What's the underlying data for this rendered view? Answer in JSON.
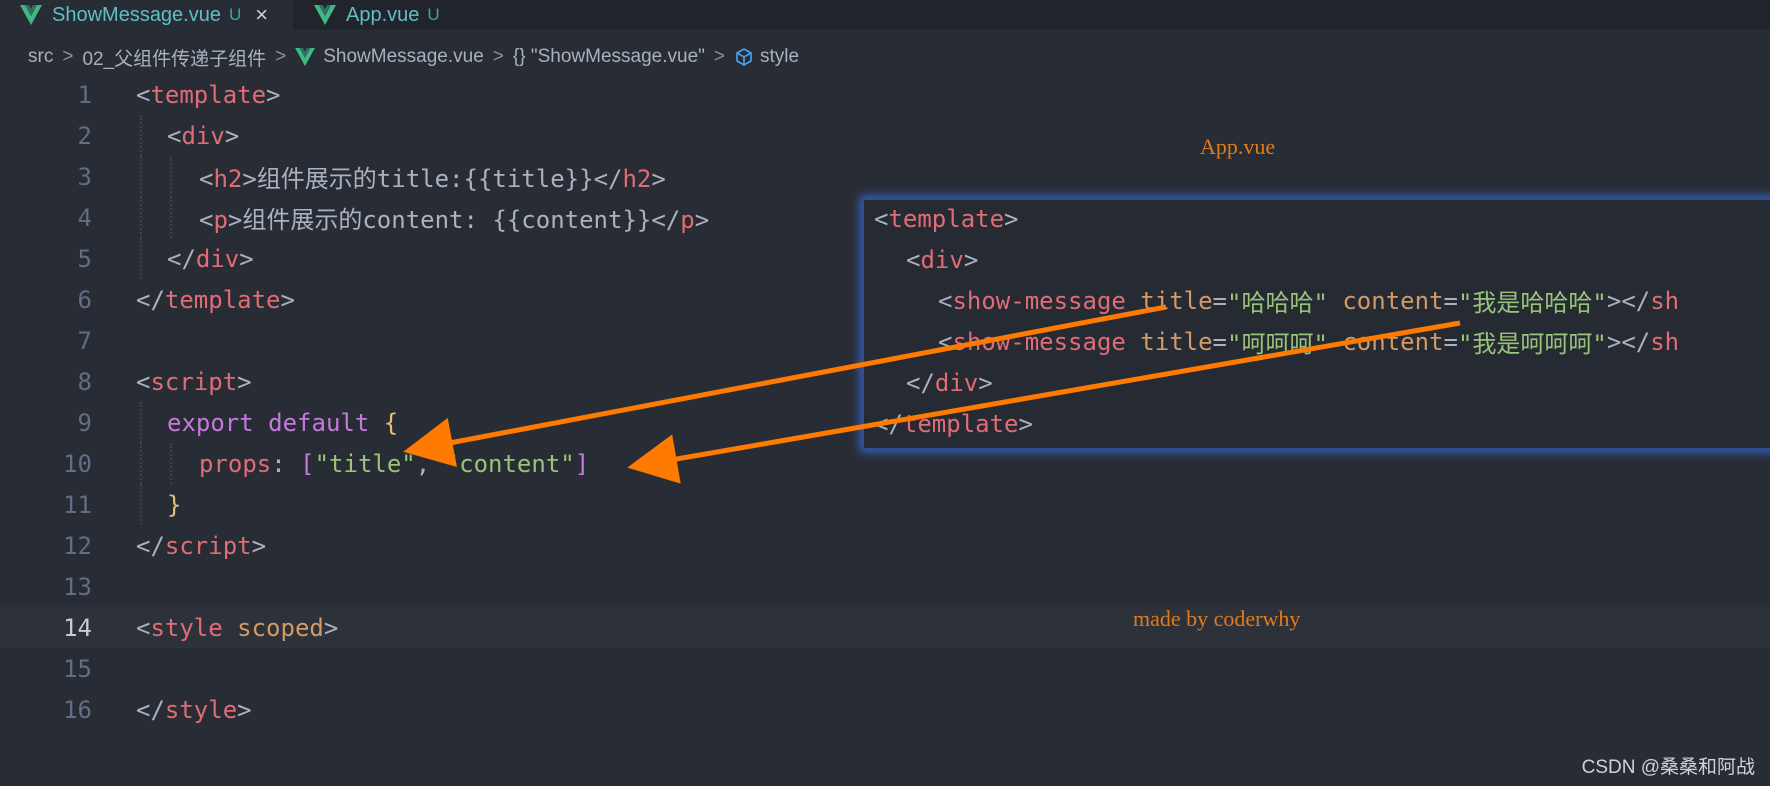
{
  "tabs": [
    {
      "name": "ShowMessage.vue",
      "status": "U",
      "close": "×",
      "icon": "vue-icon"
    },
    {
      "name": "App.vue",
      "status": "U",
      "icon": "vue-icon"
    }
  ],
  "breadcrumb": {
    "src": "src",
    "folder": "02_父组件传递子组件",
    "file": "ShowMessage.vue",
    "scope": "{} \"ShowMessage.vue\"",
    "symbol": "style",
    "separator": ">"
  },
  "editor": {
    "current_line": 14,
    "lines": [
      {
        "n": "1"
      },
      {
        "n": "2"
      },
      {
        "n": "3"
      },
      {
        "n": "4"
      },
      {
        "n": "5"
      },
      {
        "n": "6"
      },
      {
        "n": "7"
      },
      {
        "n": "8"
      },
      {
        "n": "9"
      },
      {
        "n": "10"
      },
      {
        "n": "11"
      },
      {
        "n": "12"
      },
      {
        "n": "13"
      },
      {
        "n": "14"
      },
      {
        "n": "15"
      },
      {
        "n": "16"
      }
    ],
    "code": {
      "l1": [
        "<",
        "template",
        ">"
      ],
      "l2": [
        "<",
        "div",
        ">"
      ],
      "l3": [
        "<",
        "h2",
        ">",
        "组件展示的title:{{title}}",
        "</",
        "h2",
        ">"
      ],
      "l4": [
        "<",
        "p",
        ">",
        "组件展示的content: {{content}}",
        "</",
        "p",
        ">"
      ],
      "l5": [
        "</",
        "div",
        ">"
      ],
      "l6": [
        "</",
        "template",
        ">"
      ],
      "l8": [
        "<",
        "script",
        ">"
      ],
      "l9": [
        "export",
        " ",
        "default",
        " ",
        "{"
      ],
      "l10": [
        "props",
        ": ",
        "[",
        "\"title\"",
        ", ",
        "\"content\"",
        "]"
      ],
      "l11": [
        "}"
      ],
      "l12": [
        "</",
        "script",
        ">"
      ],
      "l14": [
        "<",
        "style",
        " ",
        "scoped",
        ">"
      ],
      "l16": [
        "</",
        "style",
        ">"
      ]
    }
  },
  "overlay": {
    "label": "App.vue",
    "o1": [
      "<",
      "template",
      ">"
    ],
    "o2": [
      "<",
      "div",
      ">"
    ],
    "o3": [
      "<",
      "show-message",
      " ",
      "title",
      "=",
      "\"哈哈哈\"",
      " ",
      "content",
      "=",
      "\"我是哈哈哈\"",
      "></",
      "sh"
    ],
    "o4": [
      "<",
      "show-message",
      " ",
      "title",
      "=",
      "\"呵呵呵\"",
      " ",
      "content",
      "=",
      "\"我是呵呵呵\"",
      "></",
      "sh"
    ],
    "o5": [
      "</",
      "div",
      ">"
    ],
    "o6": [
      "</",
      "template",
      ">"
    ]
  },
  "footer_label": "made by coderwhy",
  "watermark": "CSDN @桑桑和阿战",
  "colors": {
    "arrow": "#ff7a00",
    "tag": "#e06c75",
    "string": "#98c379",
    "keyword": "#c678dd"
  }
}
